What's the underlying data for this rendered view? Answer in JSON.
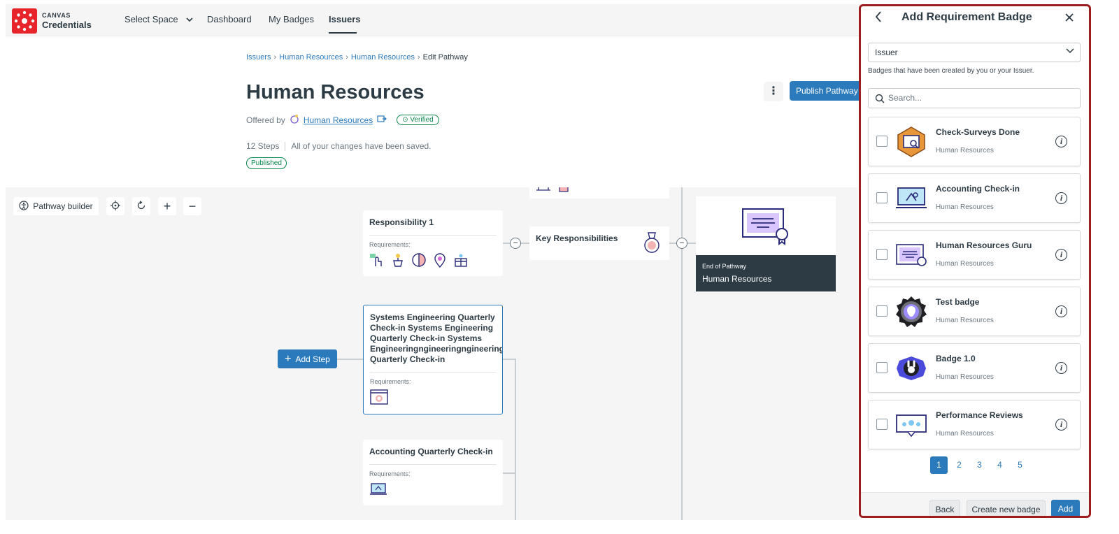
{
  "brand": {
    "top": "CANVAS",
    "bottom": "Credentials",
    "color": "#E62429"
  },
  "nav": {
    "select_space": "Select Space",
    "items": [
      {
        "label": "Dashboard"
      },
      {
        "label": "My Badges"
      },
      {
        "label": "Issuers",
        "active": true
      }
    ]
  },
  "breadcrumb": {
    "items": [
      "Issuers",
      "Human Resources",
      "Human Resources"
    ],
    "current": "Edit Pathway"
  },
  "page": {
    "title": "Human Resources",
    "offered_by": "Offered by",
    "issuer_link": "Human Resources",
    "verified": "Verified",
    "steps": "12 Steps",
    "save_status": "All of your changes have been saved.",
    "status_badge": "Published",
    "publish_button": "Publish Pathway"
  },
  "builder": {
    "pathway_builder_button": "Pathway builder",
    "add_step_button": "Add Step",
    "requirements_label": "Requirements:",
    "steps": [
      {
        "title": "Responsibility 1",
        "icons": [
          "touch-icon",
          "plant-icon",
          "half-circle-icon",
          "location-pin-icon",
          "gift-box-icon"
        ]
      },
      {
        "title": "Systems Engineering Quarterly Check-in Systems Engineering Quarterly Check-in Systems Engineeringngineeringngineeringngineeringngi Quarterly Check-in",
        "icons": [
          "browser-window-icon"
        ]
      },
      {
        "title": "Accounting Quarterly Check-in",
        "icons": [
          "laptop-icon"
        ]
      }
    ],
    "middle_step": {
      "title": "Key Responsibilities"
    },
    "end": {
      "label": "End of Pathway",
      "title": "Human Resources"
    }
  },
  "panel": {
    "title": "Add Requirement Badge",
    "select_value": "Issuer",
    "hint": "Badges that have been created by you or your Issuer.",
    "search_placeholder": "Search...",
    "badges": [
      {
        "name": "Check-Surveys Done",
        "issuer": "Human Resources",
        "icon": "survey-badge-icon"
      },
      {
        "name": "Accounting Check-in",
        "issuer": "Human Resources",
        "icon": "laptop-badge-icon"
      },
      {
        "name": "Human Resources Guru",
        "issuer": "Human Resources",
        "icon": "certificate-badge-icon"
      },
      {
        "name": "Test badge",
        "issuer": "Human Resources",
        "icon": "apple-badge-icon"
      },
      {
        "name": "Badge 1.0",
        "issuer": "Human Resources",
        "icon": "bunny-badge-icon"
      },
      {
        "name": "Performance Reviews",
        "issuer": "Human Resources",
        "icon": "stars-badge-icon"
      }
    ],
    "pages": [
      "1",
      "2",
      "3",
      "4",
      "5"
    ],
    "current_page": "1",
    "back_button": "Back",
    "create_button": "Create new badge",
    "add_button": "Add"
  },
  "colors": {
    "primary": "#2B7ABC",
    "dark": "#2D3B45",
    "success": "#0B874B",
    "panel_border": "#9B1D1D"
  }
}
